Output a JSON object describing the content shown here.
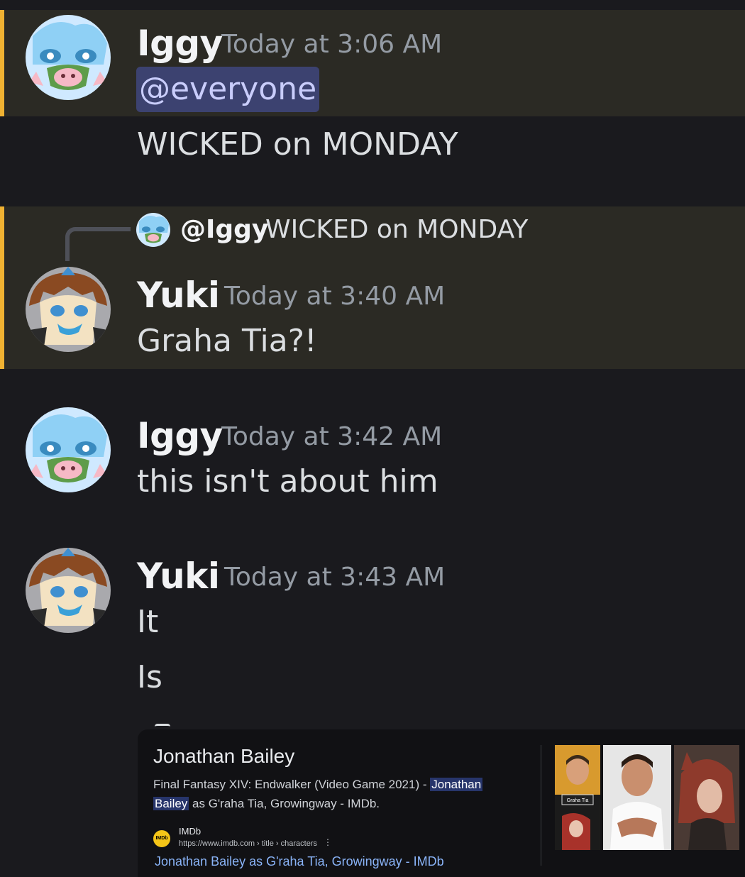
{
  "messages": {
    "m1": {
      "author": "Iggy",
      "timestamp": "Today at 3:06 AM",
      "mention": "@everyone",
      "line2": "WICKED on MONDAY"
    },
    "m2": {
      "reply_to_author": "@Iggy",
      "reply_to_text": "WICKED on MONDAY",
      "author": "Yuki",
      "timestamp": "Today at 3:40 AM",
      "text": "Graha Tia?!"
    },
    "m3": {
      "author": "Iggy",
      "timestamp": "Today at 3:42 AM",
      "text": "this isn't about him"
    },
    "m4": {
      "author": "Yuki",
      "timestamp": "Today at 3:43 AM",
      "line1": "It",
      "line2": "Is"
    }
  },
  "embed": {
    "title": "Jonathan Bailey",
    "desc_prefix": "Final Fantasy XIV: Endwalker (Video Game 2021) - ",
    "desc_hl1": "Jonathan",
    "desc_hl2": "Bailey",
    "desc_suffix": " as G'raha Tia, Growingway - IMDb.",
    "source_logo": "IMDb",
    "source_name": "IMDb",
    "source_url": "https://www.imdb.com › title › characters",
    "source_menu": "⋮",
    "link_text": "Jonathan Bailey as G'raha Tia, Growingway - IMDb",
    "thumb1_label": "Graha Tia"
  },
  "colors": {
    "highlight_bg": "#2b2a24",
    "highlight_bar": "#f0b232",
    "mention_bg": "#3c4270",
    "link": "#8ab4f8"
  },
  "icons": [
    "iggy-avatar",
    "yuki-avatar",
    "imdb-logo",
    "more-vert-icon"
  ]
}
